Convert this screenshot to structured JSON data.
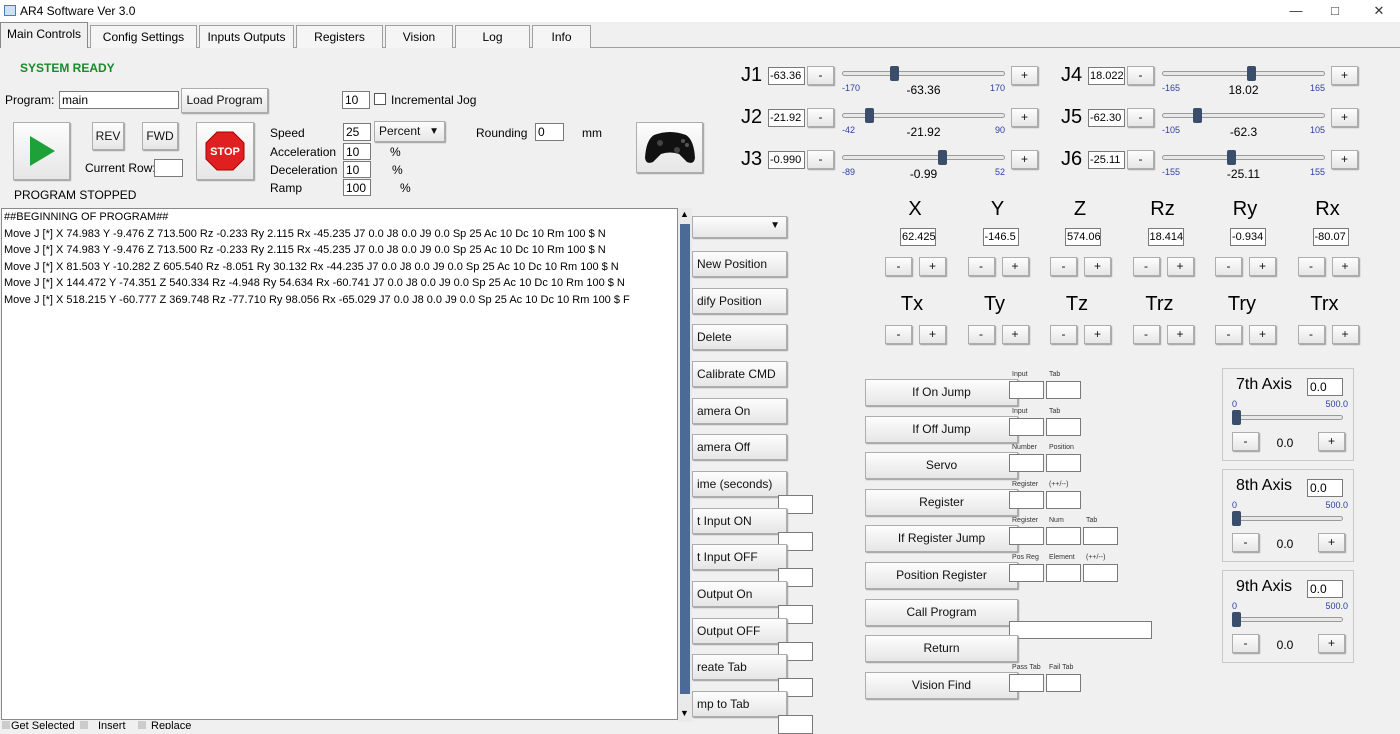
{
  "window": {
    "title": "AR4 Software Ver 3.0"
  },
  "tabs": [
    "Main Controls",
    "Config Settings",
    "Inputs Outputs",
    "Registers",
    "Vision",
    "Log",
    "Info"
  ],
  "status": {
    "system": "SYSTEM READY",
    "program_state": "PROGRAM STOPPED"
  },
  "program": {
    "label": "Program:",
    "name": "main",
    "load_label": "Load Program"
  },
  "controls": {
    "rev": "REV",
    "fwd": "FWD",
    "current_row_label": "Current Row:",
    "current_row": "",
    "stop": "STOP"
  },
  "jog": {
    "increment": "10",
    "incremental_label": "Incremental Jog"
  },
  "motion": {
    "speed_label": "Speed",
    "speed": "25",
    "speed_unit": "Percent",
    "accel_label": "Acceleration",
    "accel": "10",
    "decel_label": "Deceleration",
    "decel": "10",
    "ramp_label": "Ramp",
    "ramp": "100",
    "pct": "%",
    "rounding_label": "Rounding",
    "rounding": "0",
    "rounding_unit": "mm"
  },
  "program_lines": [
    "##BEGINNING OF PROGRAM##",
    "Move J [*] X 74.983 Y -9.476 Z 713.500 Rz -0.233 Ry 2.115 Rx -45.235 J7 0.0 J8 0.0 J9 0.0 Sp 25 Ac 10 Dc 10 Rm 100 $ N",
    "Move J [*] X 74.983 Y -9.476 Z 713.500 Rz -0.233 Ry 2.115 Rx -45.235 J7 0.0 J8 0.0 J9 0.0 Sp 25 Ac 10 Dc 10 Rm 100 $ N",
    "Move J [*] X 81.503 Y -10.282 Z 605.540 Rz -8.051 Ry 30.132 Rx -44.235 J7 0.0 J8 0.0 J9 0.0 Sp 25 Ac 10 Dc 10 Rm 100 $ N",
    "Move J [*] X 144.472 Y -74.351 Z 540.334 Rz -4.948 Ry 54.634 Rx -60.741 J7 0.0 J8 0.0 J9 0.0 Sp 25 Ac 10 Dc 10 Rm 100 $ N",
    "Move J [*] X 518.215 Y -60.777 Z 369.748 Rz -77.710 Ry 98.056 Rx -65.029 J7 0.0 J8 0.0 J9 0.0 Sp 25 Ac 10 Dc 10 Rm 100 $ F"
  ],
  "bottom_options": [
    "Get Selected",
    "Insert",
    "Replace"
  ],
  "command_buttons": [
    "New Position",
    "dify Position",
    "Delete",
    "Calibrate CMD",
    "amera On",
    "amera Off",
    "ime (seconds)",
    "t Input ON",
    "t Input OFF",
    "Output On",
    "Output OFF",
    "reate Tab",
    "mp to Tab"
  ],
  "joints": [
    {
      "name": "J1",
      "entry": "-63.36",
      "value": "-63.36",
      "min": "-170",
      "max": "170",
      "level": 0.314
    },
    {
      "name": "J2",
      "entry": "-21.92",
      "value": "-21.92",
      "min": "-42",
      "max": "90",
      "level": 0.152
    },
    {
      "name": "J3",
      "entry": "-0.990",
      "value": "-0.99",
      "min": "-89",
      "max": "52",
      "level": 0.624
    },
    {
      "name": "J4",
      "entry": "18.022",
      "value": "18.02",
      "min": "-165",
      "max": "165",
      "level": 0.555
    },
    {
      "name": "J5",
      "entry": "-62.30",
      "value": "-62.3",
      "min": "-105",
      "max": "105",
      "level": 0.203
    },
    {
      "name": "J6",
      "entry": "-25.11",
      "value": "-25.11",
      "min": "-155",
      "max": "155",
      "level": 0.419
    }
  ],
  "cartesian": [
    {
      "name": "X",
      "value": "62.425"
    },
    {
      "name": "Y",
      "value": "-146.5"
    },
    {
      "name": "Z",
      "value": "574.06"
    },
    {
      "name": "Rz",
      "value": "18.414"
    },
    {
      "name": "Ry",
      "value": "-0.934"
    },
    {
      "name": "Rx",
      "value": "-80.07"
    }
  ],
  "tool_axes": [
    "Tx",
    "Ty",
    "Tz",
    "Trz",
    "Try",
    "Trx"
  ],
  "pm": {
    "minus": "-",
    "plus": "+"
  },
  "register_cmds": [
    {
      "label": "If On Jump",
      "fields": [
        {
          "tag": "Input"
        },
        {
          "tag": "Tab"
        }
      ]
    },
    {
      "label": "If Off Jump",
      "fields": [
        {
          "tag": "Input"
        },
        {
          "tag": "Tab"
        }
      ]
    },
    {
      "label": "Servo",
      "fields": [
        {
          "tag": "Number"
        },
        {
          "tag": "Position"
        }
      ]
    },
    {
      "label": "Register",
      "fields": [
        {
          "tag": "Register"
        },
        {
          "tag": "(++/--)"
        }
      ]
    },
    {
      "label": "If Register Jump",
      "fields": [
        {
          "tag": "Register"
        },
        {
          "tag": "Num"
        },
        {
          "tag": "Tab"
        }
      ]
    },
    {
      "label": "Position Register",
      "fields": [
        {
          "tag": "Pos Reg"
        },
        {
          "tag": "Element"
        },
        {
          "tag": "(++/--)"
        }
      ]
    },
    {
      "label": "Call Program",
      "fields": []
    },
    {
      "label": "Return",
      "fields": []
    },
    {
      "label": "Vision Find",
      "fields": [
        {
          "tag": "Pass Tab"
        },
        {
          "tag": "Fail Tab"
        }
      ]
    }
  ],
  "ext_axes": [
    {
      "name": "7th Axis",
      "entry": "0.0",
      "min": "0",
      "max": "500.0",
      "value": "0.0"
    },
    {
      "name": "8th Axis",
      "entry": "0.0",
      "min": "0",
      "max": "500.0",
      "value": "0.0"
    },
    {
      "name": "9th Axis",
      "entry": "0.0",
      "min": "0",
      "max": "500.0",
      "value": "0.0"
    }
  ]
}
